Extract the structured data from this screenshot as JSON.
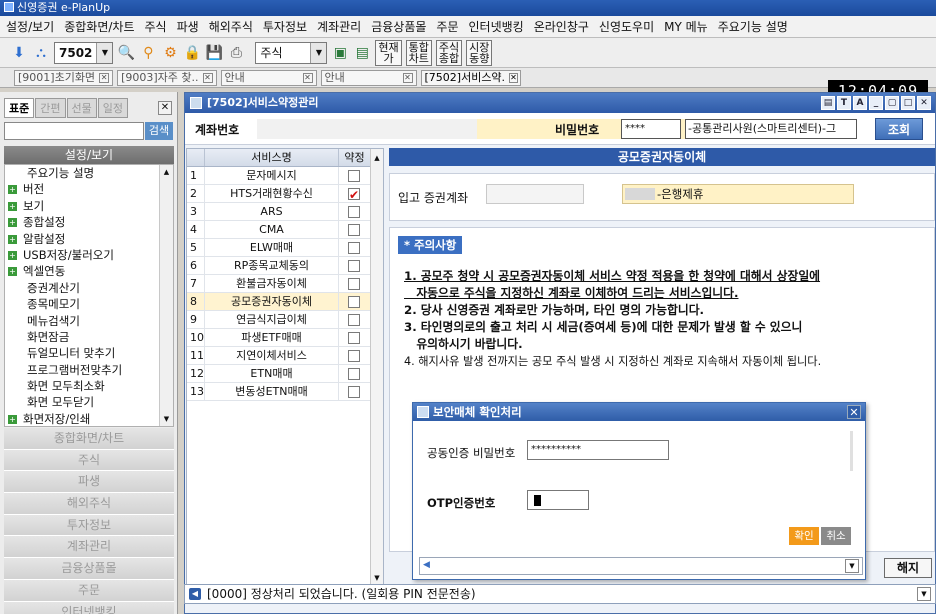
{
  "app": {
    "title": "신영증권 e-PlanUp"
  },
  "menu": [
    "설정/보기",
    "종합화면/차트",
    "주식",
    "파생",
    "해외주식",
    "투자정보",
    "계좌관리",
    "금융상품몰",
    "주문",
    "인터넷뱅킹",
    "온라인창구",
    "신영도우미",
    "MY 메뉴",
    "주요기능 설명"
  ],
  "toolbar": {
    "screen_code": "7502",
    "market_select": "주식",
    "buttons": [
      {
        "label": "현재\n가"
      },
      {
        "label": "통합\n차트"
      },
      {
        "label": "주식\n종합"
      },
      {
        "label": "시장\n동향"
      }
    ]
  },
  "open_tabs": [
    "[9001]초기화면",
    "[9003]자주 찾..",
    "안내",
    "안내",
    "[7502]서비스약."
  ],
  "clock": "12:04:09",
  "sidebar": {
    "tabs": [
      "표준",
      "간편",
      "선물",
      "일정"
    ],
    "search_button": "검색",
    "header": "설정/보기",
    "items": [
      {
        "label": "주요기능 설명",
        "group": false
      },
      {
        "label": "버전",
        "group": true
      },
      {
        "label": "보기",
        "group": true
      },
      {
        "label": "종합설정",
        "group": true
      },
      {
        "label": "알람설정",
        "group": true
      },
      {
        "label": "USB저장/불러오기",
        "group": true
      },
      {
        "label": "엑셀연동",
        "group": true
      },
      {
        "label": "증권계산기",
        "group": false
      },
      {
        "label": "종목메모기",
        "group": false
      },
      {
        "label": "메뉴검색기",
        "group": false
      },
      {
        "label": "화면잠금",
        "group": false
      },
      {
        "label": "듀얼모니터 맞추기",
        "group": false
      },
      {
        "label": "프로그램버전맞추기",
        "group": false
      },
      {
        "label": "화면 모두최소화",
        "group": false
      },
      {
        "label": "화면 모두닫기",
        "group": false
      },
      {
        "label": "화면저장/인쇄",
        "group": true
      }
    ],
    "categories": [
      "종합화면/차트",
      "주식",
      "파생",
      "해외주식",
      "투자정보",
      "계좌관리",
      "금융상품몰",
      "주문",
      "인터넷뱅킹"
    ]
  },
  "window": {
    "title": "[7502]서비스약정관리",
    "account_label": "계좌번호",
    "password_label": "비밀번호",
    "password_value": "****",
    "manager": "-공통관리사원(스마트리센터)-그",
    "inquiry_button": "조회",
    "service_table": {
      "headers": [
        "서비스명",
        "약정"
      ],
      "rows": [
        {
          "no": "1",
          "name": "문자메시지",
          "agreed": false
        },
        {
          "no": "2",
          "name": "HTS거래현황수신",
          "agreed": true
        },
        {
          "no": "3",
          "name": "ARS",
          "agreed": false
        },
        {
          "no": "4",
          "name": "CMA",
          "agreed": false
        },
        {
          "no": "5",
          "name": "ELW매매",
          "agreed": false
        },
        {
          "no": "6",
          "name": "RP종목교체동의",
          "agreed": false
        },
        {
          "no": "7",
          "name": "환불금자동이체",
          "agreed": false
        },
        {
          "no": "8",
          "name": "공모증권자동이체",
          "agreed": false,
          "selected": true
        },
        {
          "no": "9",
          "name": "연금식지급이체",
          "agreed": false
        },
        {
          "no": "10",
          "name": "파생ETF매매",
          "agreed": false
        },
        {
          "no": "11",
          "name": "지연이체서비스",
          "agreed": false
        },
        {
          "no": "12",
          "name": "ETN매매",
          "agreed": false
        },
        {
          "no": "13",
          "name": "변동성ETN매매",
          "agreed": false
        }
      ]
    },
    "detail": {
      "title": "공모증권자동이체",
      "target_label": "입고 증권계좌",
      "target_bank": "-은행제휴",
      "notice_title": "* 주의사항",
      "notices": [
        {
          "text": "1. 공모주 청약 시 공모증권자동이체 서비스 약정 적용을 한 청약에 대해서 상장일에",
          "bold": true,
          "underline": true
        },
        {
          "text": "   자동으로 주식을 지정하신 계좌로 이체하여 드리는 서비스입니다.",
          "bold": true,
          "underline": true
        },
        {
          "text": "2. 당사 신영증권 계좌로만 가능하며, 타인 명의 가능합니다.",
          "bold": true,
          "underline": false
        },
        {
          "text": "3. 타인명의로의 출고 처리 시 세금(증여세 등)에 대한 문제가 발생 할 수 있으니",
          "bold": true,
          "underline": false
        },
        {
          "text": "   유의하시기 바랍니다.",
          "bold": true,
          "underline": false
        },
        {
          "text": "4. 해지사유 발생 전까지는 공모 주식 발생 시 지정하신 계좌로 지속해서 자동이체 됩니다.",
          "bold": false,
          "underline": false
        }
      ]
    },
    "cancel_button": "해지",
    "status_message": "[0000] 정상처리 되었습니다. (일회용 PIN 전문전송)"
  },
  "dialog": {
    "title": "보안매체 확인처리",
    "cert_pw_label": "공동인증 비밀번호",
    "cert_pw_value": "**********",
    "otp_label": "OTP인증번호",
    "confirm_button": "확인",
    "cancel_button": "취소"
  }
}
